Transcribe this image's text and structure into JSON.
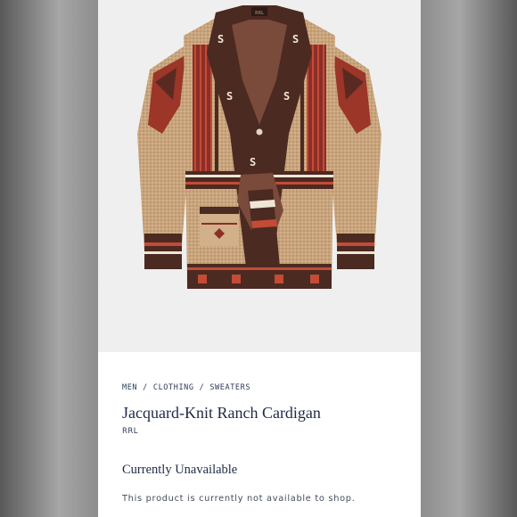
{
  "product": {
    "breadcrumb": [
      "MEN",
      "CLOTHING",
      "SWEATERS"
    ],
    "breadcrumb_separator": "/",
    "title": "Jacquard-Knit Ranch Cardigan",
    "brand": "RRL",
    "availability": "Currently Unavailable",
    "availability_note": "This product is currently not available to shop.",
    "image_subject": "cardigan-photo",
    "collar_motif": "S",
    "label_text": "RRL"
  },
  "colors": {
    "oatmeal": "#c9a57e",
    "brown": "#4b2a22",
    "rust": "#9d3a2c",
    "cream": "#efe6d6",
    "navy_text": "#1e2a46"
  }
}
